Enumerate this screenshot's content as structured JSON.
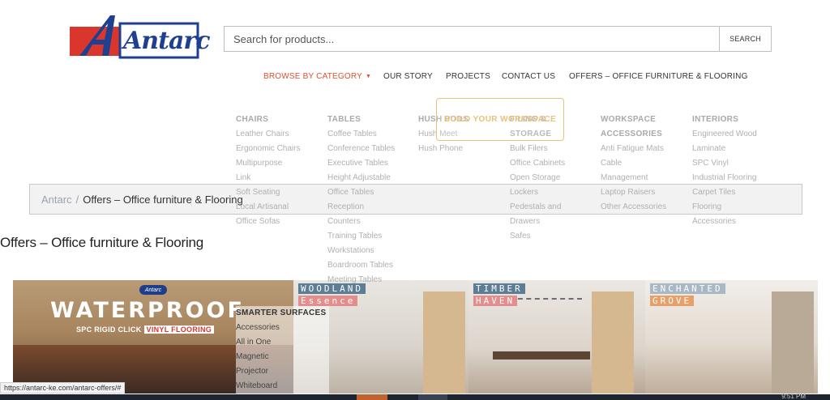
{
  "logo": {
    "text": "Antarc",
    "colors": {
      "red": "#d9372e",
      "blue": "#1f3f8f"
    }
  },
  "search": {
    "placeholder": "Search for products...",
    "button_label": "SEARCH"
  },
  "nav": {
    "items": [
      {
        "label": "BROWSE BY CATEGORY",
        "active": true
      },
      {
        "label": "OUR STORY"
      },
      {
        "label": "PROJECTS"
      },
      {
        "label": "CONTACT US"
      },
      {
        "label": "OFFERS – OFFICE FURNITURE & FLOORING"
      }
    ],
    "active_color": "#d9532f"
  },
  "mega_menu": {
    "columns": [
      {
        "heading": "CHAIRS",
        "items": [
          "Leather Chairs",
          "Ergonomic Chairs",
          "Multipurpose",
          "Link",
          "Soft Seating",
          "Local Artisanal",
          "Office Sofas"
        ]
      },
      {
        "heading": "TABLES",
        "items": [
          "Coffee Tables",
          "Conference Tables",
          "Executive Tables",
          "Height Adjustable",
          "Office Tables",
          "Reception",
          "Counters",
          "Training Tables",
          "Workstations",
          "Boardroom Tables",
          "Meeting Tables"
        ]
      },
      {
        "heading": "HUSH PODS",
        "items": [
          "Hush Meet",
          "Hush Phone"
        ]
      },
      {
        "heading": "FILING & STORAGE",
        "heading_lines": [
          "FILING &",
          "STORAGE"
        ],
        "items": [
          "Bulk Filers",
          "Office Cabinets",
          "Open Storage",
          "Lockers",
          "Pedestals and",
          "Drawers",
          "Safes"
        ]
      },
      {
        "heading": "WORKSPACE ACCESSORIES",
        "heading_lines": [
          "WORKSPACE",
          "ACCESSORIES"
        ],
        "items": [
          "Anti Fatigue Mats",
          "Cable",
          "Management",
          "Laptop Raisers",
          "Other Accessories"
        ]
      },
      {
        "heading": "INTERIORS",
        "items": [
          "Engineered Wood",
          "Laminate",
          "SPC Vinyl",
          "Industrial Flooring",
          "Carpet Tiles",
          "Flooring",
          "Accessories"
        ]
      }
    ],
    "smarter": {
      "heading": "SMARTER SURFACES",
      "items": [
        "Accessories",
        "All in One",
        "Magnetic",
        "Projector",
        "Whiteboard"
      ]
    },
    "build_button": "BUILD YOUR WORKSPACE"
  },
  "breadcrumb": {
    "home": "Antarc",
    "separator": "/",
    "current": "Offers – Office furniture & Flooring"
  },
  "page_title": "Offers – Office furniture & Flooring",
  "banners": [
    {
      "mini_logo": "Antarc",
      "headline": "WATERPROOF",
      "subline": "SPC RIGID CLICK",
      "subline_highlight": "VINYL FLOORING"
    },
    {
      "line1": "WOODLAND",
      "line2": "Essence"
    },
    {
      "line1": "TIMBER",
      "line2": "HAVEN"
    },
    {
      "line1": "ENCHANTED",
      "line2": "GROVE"
    }
  ],
  "status_bar": {
    "url": "https://antarc-ke.com/antarc-offers/#"
  },
  "taskbar": {
    "clock": "9:51 PM"
  }
}
